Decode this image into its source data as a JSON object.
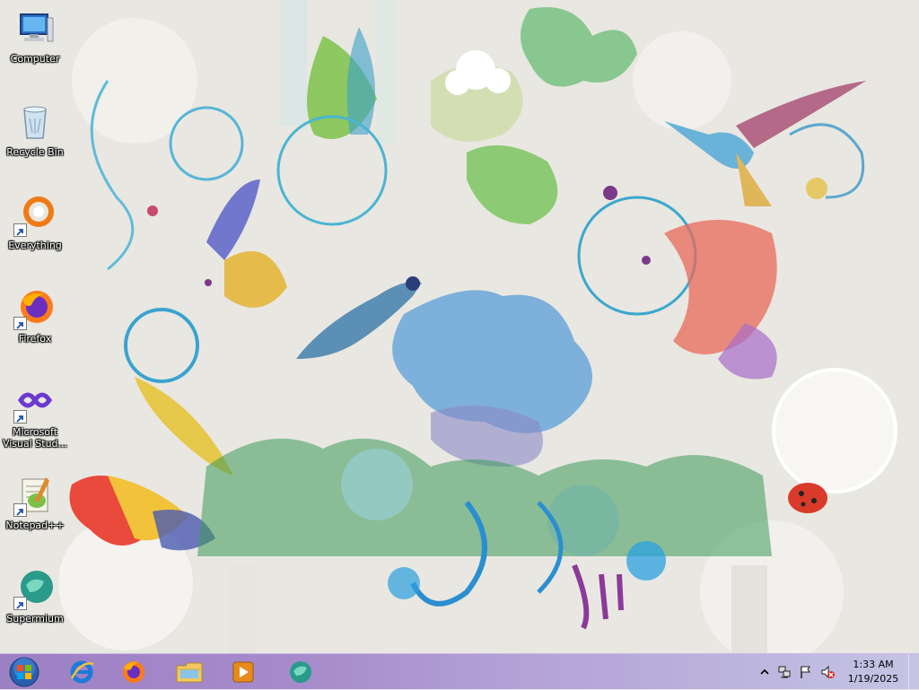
{
  "desktop": {
    "icons": [
      {
        "label": "Computer",
        "icon": "computer-icon"
      },
      {
        "label": "Recycle Bin",
        "icon": "recycle-bin-icon"
      },
      {
        "label": "Everything",
        "icon": "everything-icon"
      },
      {
        "label": "Firefox",
        "icon": "firefox-icon"
      },
      {
        "label": "Microsoft Visual Stud...",
        "icon": "visual-studio-icon"
      },
      {
        "label": "Notepad++",
        "icon": "notepad-plus-plus-icon"
      },
      {
        "label": "Supermium",
        "icon": "supermium-icon"
      }
    ]
  },
  "taskbar": {
    "start_icon": "windows-start-orb",
    "pinned": [
      "internet-explorer-icon",
      "firefox-icon",
      "file-explorer-icon",
      "windows-media-player-icon",
      "supermium-icon"
    ],
    "tray": [
      "show-hidden-icons-chevron",
      "network-icon",
      "action-center-flag-icon",
      "volume-muted-icon"
    ],
    "time": "1:33 AM",
    "date": "1/19/2025"
  },
  "colors": {
    "taskbar_start": "#9c80c4",
    "taskbar_end": "#c5c4e4",
    "wallpaper_bg": "#e9e7e1"
  }
}
